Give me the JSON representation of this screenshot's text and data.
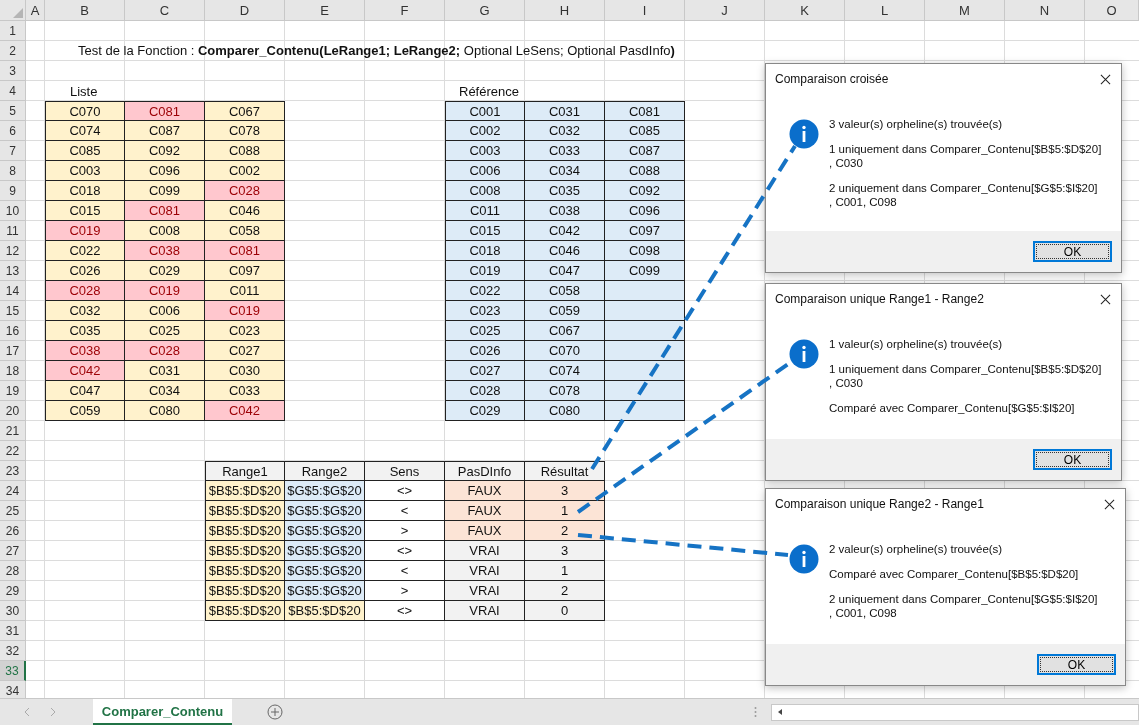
{
  "sheet": {
    "columns": [
      "A",
      "B",
      "C",
      "D",
      "E",
      "F",
      "G",
      "H",
      "I",
      "J",
      "K",
      "L",
      "M",
      "N",
      "O"
    ],
    "rows": [
      {
        "label": "1",
        "selected": false
      },
      {
        "label": "2",
        "selected": false
      },
      {
        "label": "3",
        "selected": false
      },
      {
        "label": "4",
        "selected": false
      },
      {
        "label": "5",
        "selected": false
      },
      {
        "label": "6",
        "selected": false
      },
      {
        "label": "7",
        "selected": false
      },
      {
        "label": "8",
        "selected": false
      },
      {
        "label": "9",
        "selected": false
      },
      {
        "label": "10",
        "selected": false
      },
      {
        "label": "11",
        "selected": false
      },
      {
        "label": "12",
        "selected": false
      },
      {
        "label": "13",
        "selected": false
      },
      {
        "label": "14",
        "selected": false
      },
      {
        "label": "15",
        "selected": false
      },
      {
        "label": "16",
        "selected": false
      },
      {
        "label": "17",
        "selected": false
      },
      {
        "label": "18",
        "selected": false
      },
      {
        "label": "19",
        "selected": false
      },
      {
        "label": "20",
        "selected": false
      },
      {
        "label": "21",
        "selected": false
      },
      {
        "label": "22",
        "selected": false
      },
      {
        "label": "23",
        "selected": false
      },
      {
        "label": "24",
        "selected": false
      },
      {
        "label": "25",
        "selected": false
      },
      {
        "label": "26",
        "selected": false
      },
      {
        "label": "27",
        "selected": false
      },
      {
        "label": "28",
        "selected": false
      },
      {
        "label": "29",
        "selected": false
      },
      {
        "label": "30",
        "selected": false
      },
      {
        "label": "31",
        "selected": false
      },
      {
        "label": "32",
        "selected": false
      },
      {
        "label": "33",
        "selected": true
      },
      {
        "label": "34",
        "selected": false
      }
    ]
  },
  "title_line": "Test de la Fonction : **Comparer_Contenu(LeRange1; LeRange2;** Optional LeSens; Optional PasdInfo**)**",
  "liste": {
    "label": "Liste",
    "rows": [
      [
        {
          "text": "C070",
          "flagged": false
        },
        {
          "text": "C081",
          "flagged": true
        },
        {
          "text": "C067",
          "flagged": false
        }
      ],
      [
        {
          "text": "C074",
          "flagged": false
        },
        {
          "text": "C087",
          "flagged": false
        },
        {
          "text": "C078",
          "flagged": false
        }
      ],
      [
        {
          "text": "C085",
          "flagged": false
        },
        {
          "text": "C092",
          "flagged": false
        },
        {
          "text": "C088",
          "flagged": false
        }
      ],
      [
        {
          "text": "C003",
          "flagged": false
        },
        {
          "text": "C096",
          "flagged": false
        },
        {
          "text": "C002",
          "flagged": false
        }
      ],
      [
        {
          "text": "C018",
          "flagged": false
        },
        {
          "text": "C099",
          "flagged": false
        },
        {
          "text": "C028",
          "flagged": true
        }
      ],
      [
        {
          "text": "C015",
          "flagged": false
        },
        {
          "text": "C081",
          "flagged": true
        },
        {
          "text": "C046",
          "flagged": false
        }
      ],
      [
        {
          "text": "C019",
          "flagged": true
        },
        {
          "text": "C008",
          "flagged": false
        },
        {
          "text": "C058",
          "flagged": false
        }
      ],
      [
        {
          "text": "C022",
          "flagged": false
        },
        {
          "text": "C038",
          "flagged": true
        },
        {
          "text": "C081",
          "flagged": true
        }
      ],
      [
        {
          "text": "C026",
          "flagged": false
        },
        {
          "text": "C029",
          "flagged": false
        },
        {
          "text": "C097",
          "flagged": false
        }
      ],
      [
        {
          "text": "C028",
          "flagged": true
        },
        {
          "text": "C019",
          "flagged": true
        },
        {
          "text": "C011",
          "flagged": false
        }
      ],
      [
        {
          "text": "C032",
          "flagged": false
        },
        {
          "text": "C006",
          "flagged": false
        },
        {
          "text": "C019",
          "flagged": true
        }
      ],
      [
        {
          "text": "C035",
          "flagged": false
        },
        {
          "text": "C025",
          "flagged": false
        },
        {
          "text": "C023",
          "flagged": false
        }
      ],
      [
        {
          "text": "C038",
          "flagged": true
        },
        {
          "text": "C028",
          "flagged": true
        },
        {
          "text": "C027",
          "flagged": false
        }
      ],
      [
        {
          "text": "C042",
          "flagged": true
        },
        {
          "text": "C031",
          "flagged": false
        },
        {
          "text": "C030",
          "flagged": false
        }
      ],
      [
        {
          "text": "C047",
          "flagged": false
        },
        {
          "text": "C034",
          "flagged": false
        },
        {
          "text": "C033",
          "flagged": false
        }
      ],
      [
        {
          "text": "C059",
          "flagged": false
        },
        {
          "text": "C080",
          "flagged": false
        },
        {
          "text": "C042",
          "flagged": true
        }
      ]
    ]
  },
  "reference": {
    "label": "Référence",
    "rows": [
      [
        "C001",
        "C031",
        "C081"
      ],
      [
        "C002",
        "C032",
        "C085"
      ],
      [
        "C003",
        "C033",
        "C087"
      ],
      [
        "C006",
        "C034",
        "C088"
      ],
      [
        "C008",
        "C035",
        "C092"
      ],
      [
        "C011",
        "C038",
        "C096"
      ],
      [
        "C015",
        "C042",
        "C097"
      ],
      [
        "C018",
        "C046",
        "C098"
      ],
      [
        "C019",
        "C047",
        "C099"
      ],
      [
        "C022",
        "C058"
      ],
      [
        "C023",
        "C059"
      ],
      [
        "C025",
        "C067"
      ],
      [
        "C026",
        "C070"
      ],
      [
        "C027",
        "C074"
      ],
      [
        "C028",
        "C078"
      ],
      [
        "C029",
        "C080"
      ]
    ]
  },
  "results": {
    "columns": [
      "Range1",
      "Range2",
      "Sens",
      "PasDInfo",
      "Résultat"
    ],
    "rows": [
      {
        "range1": "$B$5:$D$20",
        "range2": "$G$5:$G$20",
        "range2_is_reference": true,
        "sens": "<>",
        "pasdinfo": "FAUX",
        "result": "3",
        "highlighted": true
      },
      {
        "range1": "$B$5:$D$20",
        "range2": "$G$5:$G$20",
        "range2_is_reference": true,
        "sens": "<",
        "pasdinfo": "FAUX",
        "result": "1",
        "highlighted": true
      },
      {
        "range1": "$B$5:$D$20",
        "range2": "$G$5:$G$20",
        "range2_is_reference": true,
        "sens": ">",
        "pasdinfo": "FAUX",
        "result": "2",
        "highlighted": true
      },
      {
        "range1": "$B$5:$D$20",
        "range2": "$G$5:$G$20",
        "range2_is_reference": true,
        "sens": "<>",
        "pasdinfo": "VRAI",
        "result": "3",
        "highlighted": false
      },
      {
        "range1": "$B$5:$D$20",
        "range2": "$G$5:$G$20",
        "range2_is_reference": true,
        "sens": "<",
        "pasdinfo": "VRAI",
        "result": "1",
        "highlighted": false
      },
      {
        "range1": "$B$5:$D$20",
        "range2": "$G$5:$G$20",
        "range2_is_reference": true,
        "sens": ">",
        "pasdinfo": "VRAI",
        "result": "2",
        "highlighted": false
      },
      {
        "range1": "$B$5:$D$20",
        "range2": "$B$5:$D$20",
        "range2_is_reference": false,
        "sens": "<>",
        "pasdinfo": "VRAI",
        "result": "0",
        "highlighted": false
      }
    ]
  },
  "dialogs": [
    {
      "title": "Comparaison croisée",
      "paragraphs": [
        [
          "3 valeur(s) orpheline(s) trouvée(s)"
        ],
        [
          "1 uniquement dans Comparer_Contenu[$B$5:$D$20]",
          ", C030"
        ],
        [
          "2 uniquement dans Comparer_Contenu[$G$5:$I$20]",
          ", C001, C098"
        ]
      ],
      "button": "OK"
    },
    {
      "title": "Comparaison unique Range1 - Range2",
      "paragraphs": [
        [
          "1 valeur(s) orpheline(s) trouvée(s)"
        ],
        [
          "1 uniquement dans Comparer_Contenu[$B$5:$D$20]",
          ", C030"
        ],
        [
          "Comparé avec Comparer_Contenu[$G$5:$I$20]"
        ]
      ],
      "button": "OK"
    },
    {
      "title": "Comparaison unique Range2 - Range1",
      "paragraphs": [
        [
          "2 valeur(s) orpheline(s) trouvée(s)"
        ],
        [
          "Comparé avec Comparer_Contenu[$B$5:$D$20]"
        ],
        [
          "2 uniquement dans Comparer_Contenu[$G$5:$I$20]",
          ", C001, C098"
        ]
      ],
      "button": "OK"
    }
  ],
  "sheet_tabs": [
    {
      "label": "Comparer_Contenu",
      "selected": true
    }
  ]
}
